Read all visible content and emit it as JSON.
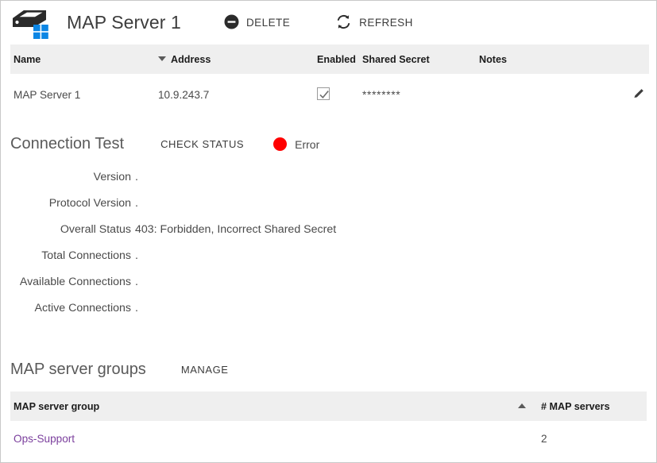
{
  "header": {
    "icon": "windows-server-icon",
    "title": "MAP Server 1",
    "delete_label": "DELETE",
    "delete_icon": "minus-circle-icon",
    "refresh_label": "REFRESH",
    "refresh_icon": "refresh-icon"
  },
  "server_table": {
    "columns": [
      {
        "label": "Name",
        "sort": "none"
      },
      {
        "label": "Address",
        "sort": "desc"
      },
      {
        "label": "Enabled",
        "sort": "none"
      },
      {
        "label": "Shared Secret",
        "sort": "none"
      },
      {
        "label": "Notes",
        "sort": "none"
      }
    ],
    "rows": [
      {
        "name": "MAP Server 1",
        "address": "10.9.243.7",
        "enabled": true,
        "shared_secret": "********",
        "notes": "",
        "edit_icon": "pencil-icon"
      }
    ]
  },
  "connection_test": {
    "title": "Connection Test",
    "check_status_label": "CHECK STATUS",
    "status_text": "Error",
    "status_color": "#ff0000",
    "fields": [
      {
        "label": "Version",
        "value": "."
      },
      {
        "label": "Protocol Version",
        "value": "."
      },
      {
        "label": "Overall Status",
        "value": "403: Forbidden, Incorrect Shared Secret"
      },
      {
        "label": "Total Connections",
        "value": "."
      },
      {
        "label": "Available Connections",
        "value": "."
      },
      {
        "label": "Active Connections",
        "value": "."
      }
    ]
  },
  "groups": {
    "title": "MAP server groups",
    "manage_label": "MANAGE",
    "columns": [
      {
        "label": "MAP server group",
        "sort": "asc"
      },
      {
        "label": "# MAP servers",
        "sort": "none"
      }
    ],
    "rows": [
      {
        "name": "Ops-Support",
        "count": "2"
      }
    ]
  },
  "colors": {
    "header_band": "#efefef",
    "link": "#7b3f9d",
    "error": "#ff0000",
    "windows_blue": "#0c86e4"
  }
}
